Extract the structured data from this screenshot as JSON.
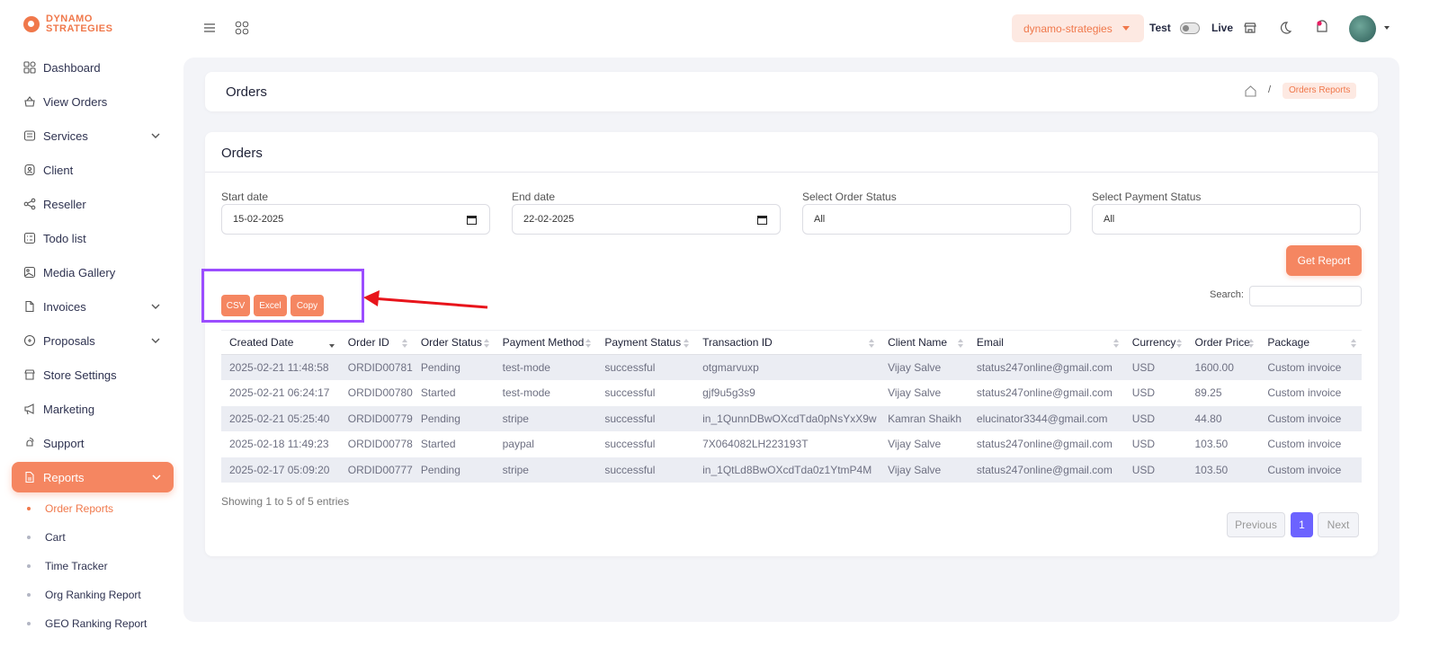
{
  "brand": {
    "line1": "DYNAMO",
    "line2": "STRATEGIES"
  },
  "sidebar": {
    "items": [
      {
        "label": "Dashboard",
        "icon": "dashboard-icon"
      },
      {
        "label": "View Orders",
        "icon": "basket-icon"
      },
      {
        "label": "Services",
        "icon": "services-icon",
        "has_children": true
      },
      {
        "label": "Client",
        "icon": "client-icon"
      },
      {
        "label": "Reseller",
        "icon": "reseller-icon"
      },
      {
        "label": "Todo list",
        "icon": "todo-icon"
      },
      {
        "label": "Media Gallery",
        "icon": "media-icon"
      },
      {
        "label": "Invoices",
        "icon": "invoice-icon",
        "has_children": true
      },
      {
        "label": "Proposals",
        "icon": "proposal-icon",
        "has_children": true
      },
      {
        "label": "Store Settings",
        "icon": "store-icon"
      },
      {
        "label": "Marketing",
        "icon": "megaphone-icon"
      },
      {
        "label": "Support",
        "icon": "support-icon"
      },
      {
        "label": "Reports",
        "icon": "reports-icon",
        "has_children": true,
        "active": true
      }
    ],
    "subitems": [
      {
        "label": "Order Reports",
        "active": true
      },
      {
        "label": "Cart"
      },
      {
        "label": "Time Tracker"
      },
      {
        "label": "Org Ranking Report"
      },
      {
        "label": "GEO Ranking Report"
      }
    ]
  },
  "topbar": {
    "store": "dynamo-strategies",
    "mode_test": "Test",
    "mode_live": "Live"
  },
  "header": {
    "title": "Orders",
    "breadcrumb_current": "Orders Reports"
  },
  "report": {
    "title": "Orders",
    "filters": {
      "start_label": "Start date",
      "start_value": "15-02-2025",
      "end_label": "End date",
      "end_value": "22-02-2025",
      "order_status_label": "Select Order Status",
      "order_status_value": "All",
      "payment_status_label": "Select Payment Status",
      "payment_status_value": "All"
    },
    "get_report": "Get Report",
    "export": {
      "csv": "CSV",
      "excel": "Excel",
      "copy": "Copy"
    },
    "search_label": "Search:",
    "columns": [
      "Created Date",
      "Order ID",
      "Order Status",
      "Payment Method",
      "Payment Status",
      "Transaction ID",
      "Client Name",
      "Email",
      "Currency",
      "Order Price",
      "Package"
    ],
    "rows": [
      [
        "2025-02-21 11:48:58",
        "ORDID00781",
        "Pending",
        "test-mode",
        "successful",
        "otgmarvuxp",
        "Vijay Salve",
        "status247online@gmail.com",
        "USD",
        "1600.00",
        "Custom invoice"
      ],
      [
        "2025-02-21 06:24:17",
        "ORDID00780",
        "Started",
        "test-mode",
        "successful",
        "gjf9u5g3s9",
        "Vijay Salve",
        "status247online@gmail.com",
        "USD",
        "89.25",
        "Custom invoice"
      ],
      [
        "2025-02-21 05:25:40",
        "ORDID00779",
        "Pending",
        "stripe",
        "successful",
        "in_1QunnDBwOXcdTda0pNsYxX9w",
        "Kamran Shaikh",
        "elucinator3344@gmail.com",
        "USD",
        "44.80",
        "Custom invoice"
      ],
      [
        "2025-02-18 11:49:23",
        "ORDID00778",
        "Started",
        "paypal",
        "successful",
        "7X064082LH223193T",
        "Vijay Salve",
        "status247online@gmail.com",
        "USD",
        "103.50",
        "Custom invoice"
      ],
      [
        "2025-02-17 05:09:20",
        "ORDID00777",
        "Pending",
        "stripe",
        "successful",
        "in_1QtLd8BwOXcdTda0z1YtmP4M",
        "Vijay Salve",
        "status247online@gmail.com",
        "USD",
        "103.50",
        "Custom invoice"
      ]
    ],
    "showing": "Showing 1 to 5 of 5 entries",
    "pagination": {
      "previous": "Previous",
      "current": "1",
      "next": "Next"
    }
  },
  "colors": {
    "accent": "#f58661",
    "brand": "#f0784b",
    "page_active": "#6c63ff",
    "annotation": "#9b4dff",
    "arrow": "#e8141b"
  }
}
